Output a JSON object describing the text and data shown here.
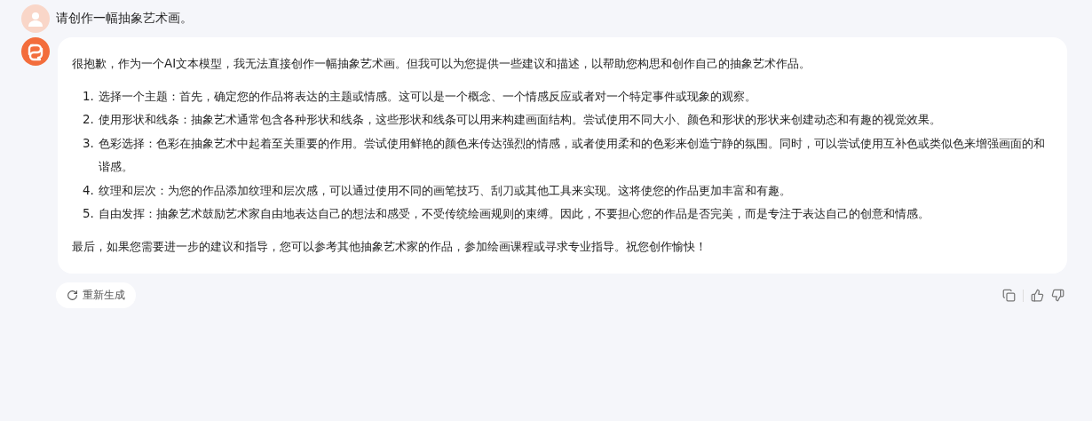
{
  "user_message": {
    "text": "请创作一幅抽象艺术画。"
  },
  "reply": {
    "intro": "很抱歉，作为一个AI文本模型，我无法直接创作一幅抽象艺术画。但我可以为您提供一些建议和描述，以帮助您构思和创作自己的抽象艺术作品。",
    "items": [
      {
        "number": "1.",
        "text": "选择一个主题：首先，确定您的作品将表达的主题或情感。这可以是一个概念、一个情感反应或者对一个特定事件或现象的观察。"
      },
      {
        "number": "2.",
        "text": "使用形状和线条：抽象艺术通常包含各种形状和线条，这些形状和线条可以用来构建画面结构。尝试使用不同大小、颜色和形状的形状来创建动态和有趣的视觉效果。"
      },
      {
        "number": "3.",
        "text": "色彩选择：色彩在抽象艺术中起着至关重要的作用。尝试使用鲜艳的颜色来传达强烈的情感，或者使用柔和的色彩来创造宁静的氛围。同时，可以尝试使用互补色或类似色来增强画面的和谐感。"
      },
      {
        "number": "4.",
        "text": "纹理和层次：为您的作品添加纹理和层次感，可以通过使用不同的画笔技巧、刮刀或其他工具来实现。这将使您的作品更加丰富和有趣。"
      },
      {
        "number": "5.",
        "text": "自由发挥：抽象艺术鼓励艺术家自由地表达自己的想法和感受，不受传统绘画规则的束缚。因此，不要担心您的作品是否完美，而是专注于表达自己的创意和情感。"
      }
    ],
    "outro": "最后，如果您需要进一步的建议和指导，您可以参考其他抽象艺术家的作品，参加绘画课程或寻求专业指导。祝您创作愉快！"
  },
  "actions": {
    "regenerate": "重新生成"
  }
}
